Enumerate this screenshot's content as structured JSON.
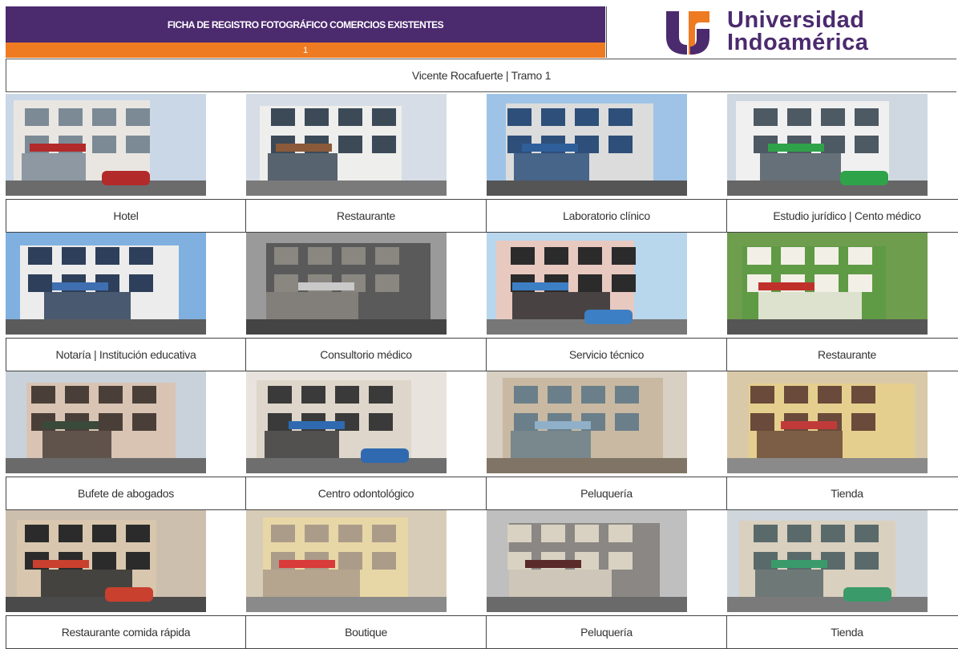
{
  "header": {
    "title": "FICHA DE REGISTRO FOTOGRÁFICO COMERCIOS EXISTENTES",
    "number": "1",
    "logo_line1": "Universidad",
    "logo_line2": "Indoamérica",
    "brand_purple": "#4b2a6e",
    "brand_orange": "#ee7b22"
  },
  "subtitle": "Vicente Rocafuerte | Tramo 1",
  "photos": [
    {
      "caption": "Hotel",
      "scene": "hotel-building-photo"
    },
    {
      "caption": "Restaurante",
      "scene": "restaurant-facade-photo"
    },
    {
      "caption": "Laboratorio clínico",
      "scene": "clinical-lab-building-photo"
    },
    {
      "caption": "Estudio jurídico | Cento médico",
      "scene": "law-office-building-photo"
    },
    {
      "caption": "Notaría | Institución educativa",
      "scene": "notary-building-photo"
    },
    {
      "caption": "Consultorio médico",
      "scene": "medical-office-photo"
    },
    {
      "caption": "Servicio técnico",
      "scene": "tech-service-shop-photo"
    },
    {
      "caption": "Restaurante",
      "scene": "restaurant-window-photo"
    },
    {
      "caption": "Bufete de abogados",
      "scene": "law-firm-building-photo"
    },
    {
      "caption": "Centro odontológico",
      "scene": "dental-center-photo"
    },
    {
      "caption": "Peluquería",
      "scene": "hair-salon-street-photo"
    },
    {
      "caption": "Tienda",
      "scene": "shop-street-photo"
    },
    {
      "caption": "Restaurante comida rápida",
      "scene": "fast-food-restaurant-photo"
    },
    {
      "caption": "Boutique",
      "scene": "boutique-street-photo"
    },
    {
      "caption": "Peluquería",
      "scene": "hair-salon-facade-photo"
    },
    {
      "caption": "Tienda",
      "scene": "shop-intersection-photo"
    }
  ]
}
